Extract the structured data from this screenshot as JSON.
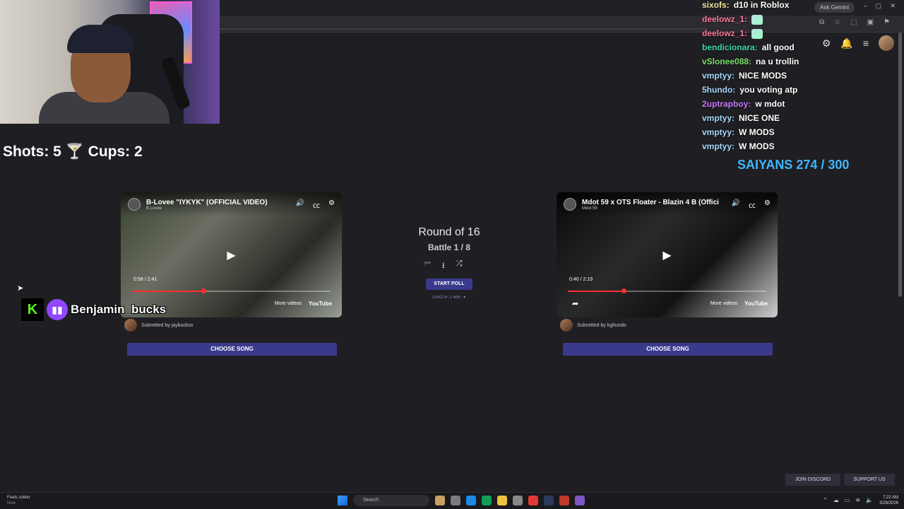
{
  "browser": {
    "ask_gemini": "Ask Gemini",
    "window_controls": [
      "–",
      "▢",
      "✕"
    ]
  },
  "chat": [
    {
      "user": "sixofs:",
      "message": "d10 in Roblox",
      "color": "#f5e79e"
    },
    {
      "user": "deelowz_1:",
      "message": "",
      "color": "#ff7a9c",
      "emote": true
    },
    {
      "user": "deelowz_1:",
      "message": "",
      "color": "#ff7a9c",
      "emote": true
    },
    {
      "user": "bendicionara:",
      "message": "all good",
      "color": "#3dd9a8"
    },
    {
      "user": "vSlonee088:",
      "message": "na u trollin",
      "color": "#7be36b"
    },
    {
      "user": "vmptyy:",
      "message": "NICE MODS",
      "color": "#a7d8ff"
    },
    {
      "user": "5hundo:",
      "message": "you voting atp",
      "color": "#a7d8ff"
    },
    {
      "user": "2uptrapboy:",
      "message": "w mdot",
      "color": "#c97bff"
    },
    {
      "user": "vmptyy:",
      "message": "NICE ONE",
      "color": "#a7d8ff"
    },
    {
      "user": "vmptyy:",
      "message": "W MODS",
      "color": "#a7d8ff"
    },
    {
      "user": "vmptyy:",
      "message": "W MODS",
      "color": "#a7d8ff"
    }
  ],
  "stats": {
    "shots_cups": "Shots: 5 🍸 Cups: 2",
    "saiyans": "SAIYANS 274 / 300"
  },
  "battle": {
    "round": "Round of 16",
    "battle": "Battle 1 / 8",
    "start_poll": "START POLL",
    "length": "LENGTH: 1 MIN. ▼"
  },
  "videos": {
    "left": {
      "title": "B-Lovee \"IYKYK\" (OFFICIAL VIDEO)",
      "channel": "B Lovee",
      "time": "0:58 / 2:41",
      "progress": 0.36,
      "more_videos": "More videos",
      "youtube": "YouTube",
      "submitted": "Submitted by jaybucksx",
      "choose": "CHOOSE SONG"
    },
    "right": {
      "title": "Mdot 59 x OTS Floater - Blazin 4 B (Offici",
      "channel": "Mdot 59",
      "time": "0:40 / 2:19",
      "progress": 0.28,
      "more_videos": "More videos",
      "youtube": "YouTube",
      "submitted": "Submitted by kghundo",
      "choose": "CHOOSE SONG"
    }
  },
  "streamer": {
    "handle": "Benjamin_bucks",
    "kick_letter": "K"
  },
  "footer": {
    "join_discord": "JOIN DISCORD",
    "support_us": "SUPPORT US"
  },
  "taskbar": {
    "weather": "Feels colder",
    "weather_sub": "Now",
    "search": "Search",
    "time": "7:22 AM",
    "date": "3/28/2026"
  },
  "icons": {
    "settings": "gear-icon",
    "notifications": "bell-icon",
    "menu": "hamburger-icon"
  }
}
